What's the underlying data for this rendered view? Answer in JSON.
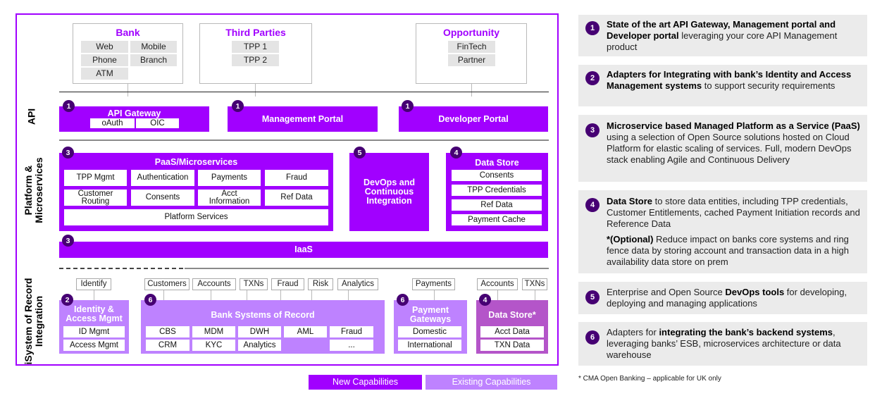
{
  "colors": {
    "new_capability": "#a100ff",
    "existing_capability": "#be82ff",
    "existing_data_store": "#b455c9",
    "badge": "#460073",
    "frame": "#a100ff",
    "description_panel": "#ebebeb",
    "chip": "#e4e4e4"
  },
  "layers": {
    "api": "API",
    "platform_line1": "Platform &",
    "platform_line2": "Microservices",
    "sor_line1": "iSystem of Record",
    "sor_line2": "Integration"
  },
  "sources": {
    "bank": {
      "title": "Bank",
      "items": [
        "Web",
        "Mobile",
        "Phone",
        "Branch",
        "ATM"
      ]
    },
    "third_parties": {
      "title": "Third Parties",
      "items": [
        "TPP 1",
        "TPP 2"
      ]
    },
    "opportunity": {
      "title": "Opportunity",
      "items": [
        "FinTech",
        "Partner"
      ]
    }
  },
  "api": {
    "gateway": {
      "badge": "1",
      "title": "API Gateway",
      "items": [
        "oAuth",
        "OIC"
      ]
    },
    "management_portal": {
      "badge": "1",
      "title": "Management Portal"
    },
    "developer_portal": {
      "badge": "1",
      "title": "Developer Portal"
    }
  },
  "platform": {
    "paas": {
      "badge": "3",
      "title": "PaaS/Microservices",
      "cells": [
        "TPP Mgmt",
        "Authentication",
        "Payments",
        "Fraud",
        "Customer Routing",
        "Consents",
        "Acct Information",
        "Ref Data"
      ],
      "footer": "Platform Services"
    },
    "devops": {
      "badge": "5",
      "title": "DevOps and Continuous Integration"
    },
    "data_store": {
      "badge": "4",
      "title": "Data Store",
      "items": [
        "Consents",
        "TPP Credentials",
        "Ref Data",
        "Payment Cache"
      ]
    },
    "iaas": {
      "badge": "3",
      "title": "IaaS"
    }
  },
  "sor": {
    "iam": {
      "badge": "2",
      "title": "Identity & Access Mgmt",
      "tags": [
        "Identify"
      ],
      "items": [
        "ID Mgmt",
        "Access Mgmt"
      ]
    },
    "bank_sor": {
      "badge": "6",
      "title": "Bank Systems of Record",
      "tags": [
        "Customers",
        "Accounts",
        "TXNs",
        "Fraud",
        "Risk",
        "Analytics"
      ],
      "row1": [
        "CBS",
        "MDM",
        "DWH",
        "AML",
        "Fraud"
      ],
      "row2": [
        "CRM",
        "KYC",
        "Analytics",
        "..."
      ]
    },
    "payment_gateways": {
      "badge": "6",
      "title": "Payment Gateways",
      "tags": [
        "Payments"
      ],
      "items": [
        "Domestic",
        "International"
      ]
    },
    "data_store_opt": {
      "badge": "4",
      "title": "Data Store*",
      "tags": [
        "Accounts",
        "TXNs"
      ],
      "items": [
        "Acct Data",
        "TXN Data"
      ]
    }
  },
  "legend": {
    "new": "New Capabilities",
    "existing": "Existing Capabilities"
  },
  "descriptions": [
    {
      "badge": "1",
      "bold": "State of the art API Gateway, Management portal and Developer portal",
      "text": " leveraging your core API Management product"
    },
    {
      "badge": "2",
      "bold": "Adapters for Integrating with bank’s Identity and Access Management systems",
      "text": " to support security requirements"
    },
    {
      "badge": "3",
      "bold": "Microservice based Managed Platform as a Service (PaaS)",
      "text": " using a selection of Open Source solutions hosted on Cloud Platform for elastic scaling of services. Full, modern DevOps stack enabling Agile and Continuous Delivery"
    },
    {
      "badge": "4",
      "bold": "Data Store",
      "text": " to store data entities, including TPP credentials, Customer Entitlements, cached Payment Initiation records and Reference Data",
      "bold2": "*(Optional)",
      "text2": " Reduce impact on banks core systems and ring fence data by storing account and transaction data in a high availability data store on prem"
    },
    {
      "badge": "5",
      "pre": "Enterprise and Open Source ",
      "bold": "DevOps tools",
      "text": " for developing, deploying and managing applications"
    },
    {
      "badge": "6",
      "pre": "Adapters for ",
      "bold": "integrating the bank’s backend systems",
      "text": ", leveraging banks’ ESB, microservices architecture or data warehouse"
    }
  ],
  "footnote": "* CMA Open Banking – applicable for UK only"
}
